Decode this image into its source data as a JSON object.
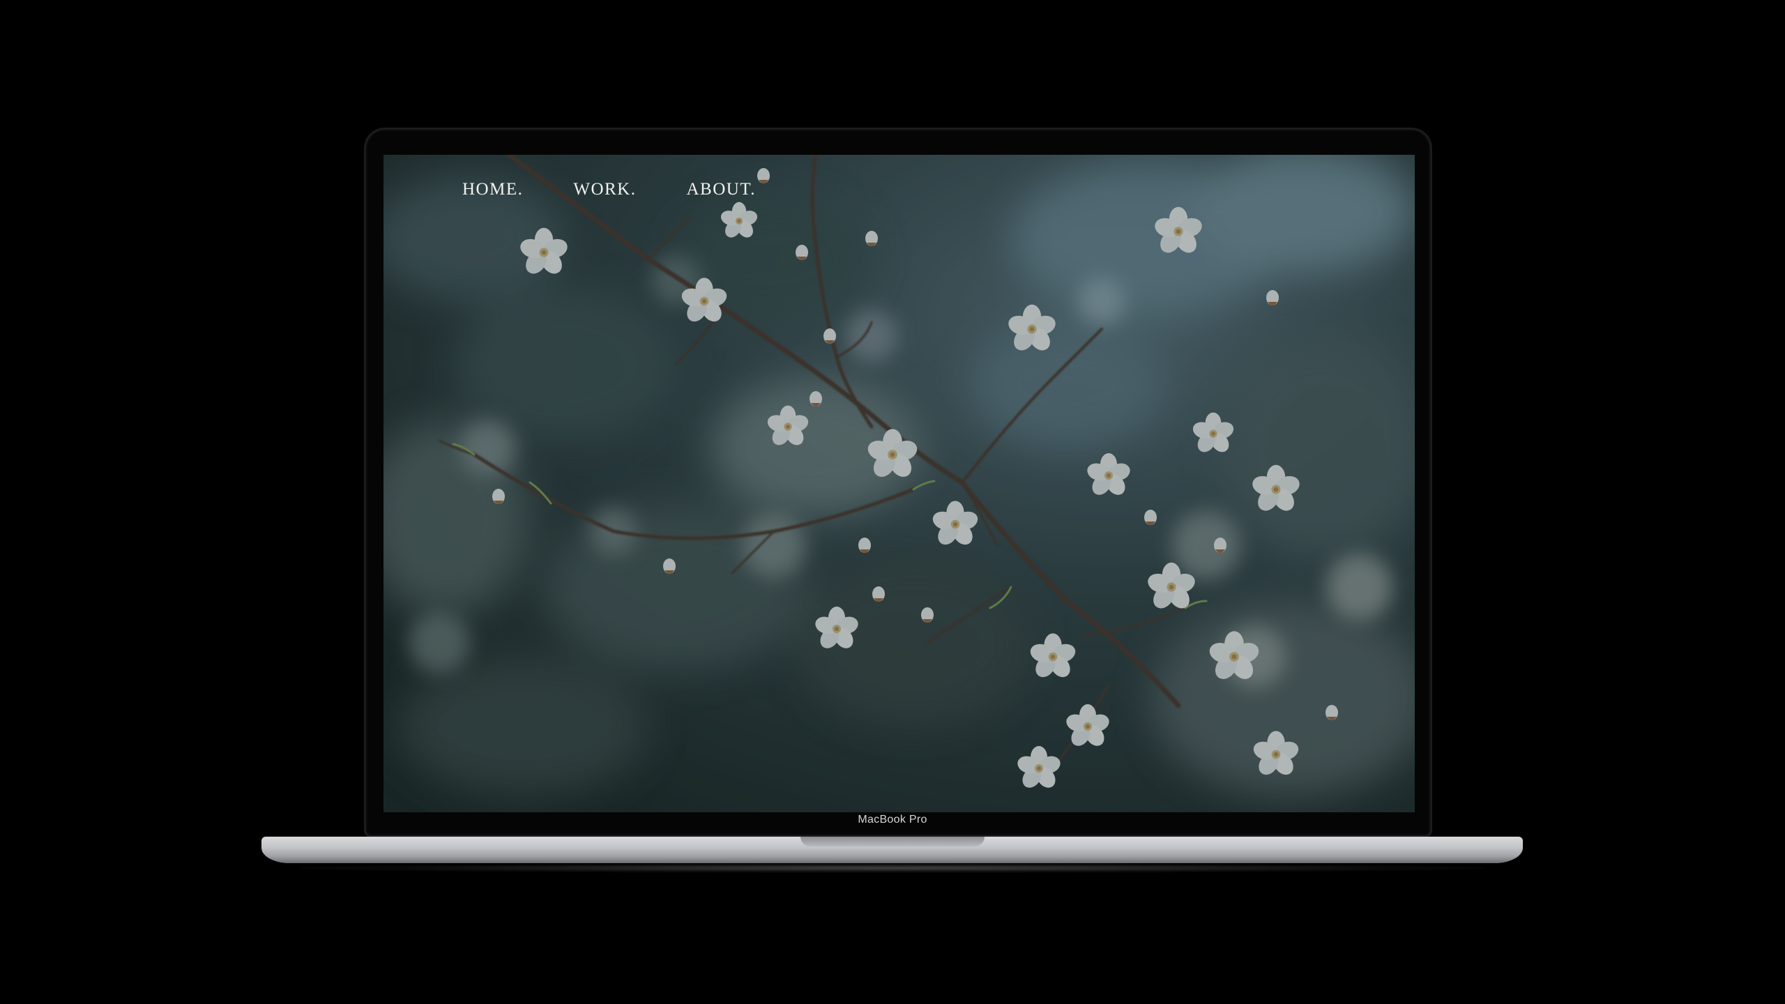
{
  "nav": {
    "items": [
      {
        "label": "HOME."
      },
      {
        "label": "WORK."
      },
      {
        "label": "ABOUT."
      }
    ]
  },
  "device": {
    "label": "MacBook Pro"
  },
  "hero": {
    "image": "blossom-branch-photo"
  },
  "colors": {
    "nav_text": "#f2f2ee",
    "background": "#000000",
    "photo_bokeh": "#2a3a3f",
    "blossom": "#e9ecec"
  }
}
